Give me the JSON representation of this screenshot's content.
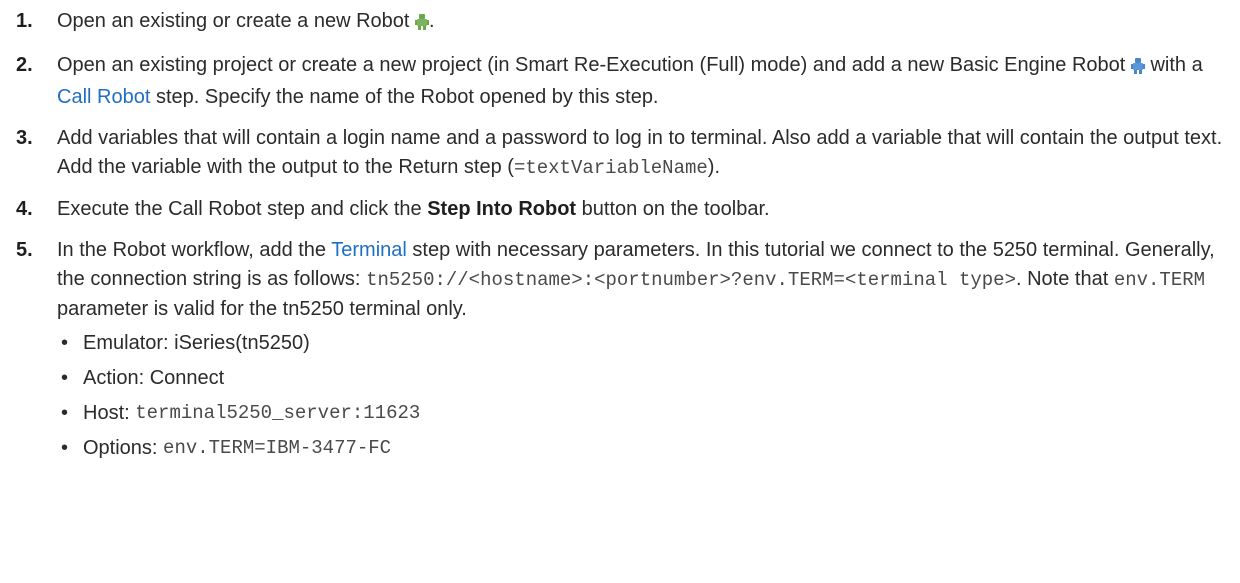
{
  "steps": [
    {
      "num": "1.",
      "t1": "Open an existing or create a new Robot",
      "t2": "."
    },
    {
      "num": "2.",
      "t1": "Open an existing project or create a new project (in Smart Re-Execution (Full) mode) and add a new Basic Engine Robot",
      "t2": "with a",
      "link": "Call Robot",
      "t3": "step. Specify the name of the Robot opened by this step."
    },
    {
      "num": "3.",
      "t1": "Add variables that will contain a login name and a password to log in to terminal. Also add a variable that will contain the output text. Add the variable with the output to the Return step (",
      "code": "=textVariableName",
      "t2": ")."
    },
    {
      "num": "4.",
      "t1": "Execute the Call Robot step and click the",
      "bold": "Step Into Robot",
      "t2": "button on the toolbar."
    },
    {
      "num": "5.",
      "t1": "In the Robot workflow, add the",
      "link": "Terminal",
      "t2": "step with necessary parameters. In this tutorial we connect to the 5250 terminal. Generally, the connection string is as follows:",
      "code1": "tn5250://<hostname>:<portnumber>?env.TERM=<terminal type>",
      "t3": ". Note that",
      "code2": "env.TERM",
      "t4": "parameter is valid for the tn5250 terminal only.",
      "bullets": [
        {
          "label": "Emulator: iSeries(tn5250)",
          "code": ""
        },
        {
          "label": "Action: Connect",
          "code": ""
        },
        {
          "label": "Host: ",
          "code": "terminal5250_server:11623"
        },
        {
          "label": "Options: ",
          "code": "env.TERM=IBM-3477-FC"
        }
      ]
    }
  ],
  "icons": {
    "robot_icon": "robot-icon",
    "basic_robot_icon": "basic-engine-robot-icon",
    "bullet": "•"
  },
  "colors": {
    "link": "#1f6fc2",
    "robot_green": "#6aa84f",
    "robot_blue": "#4a86c8"
  }
}
